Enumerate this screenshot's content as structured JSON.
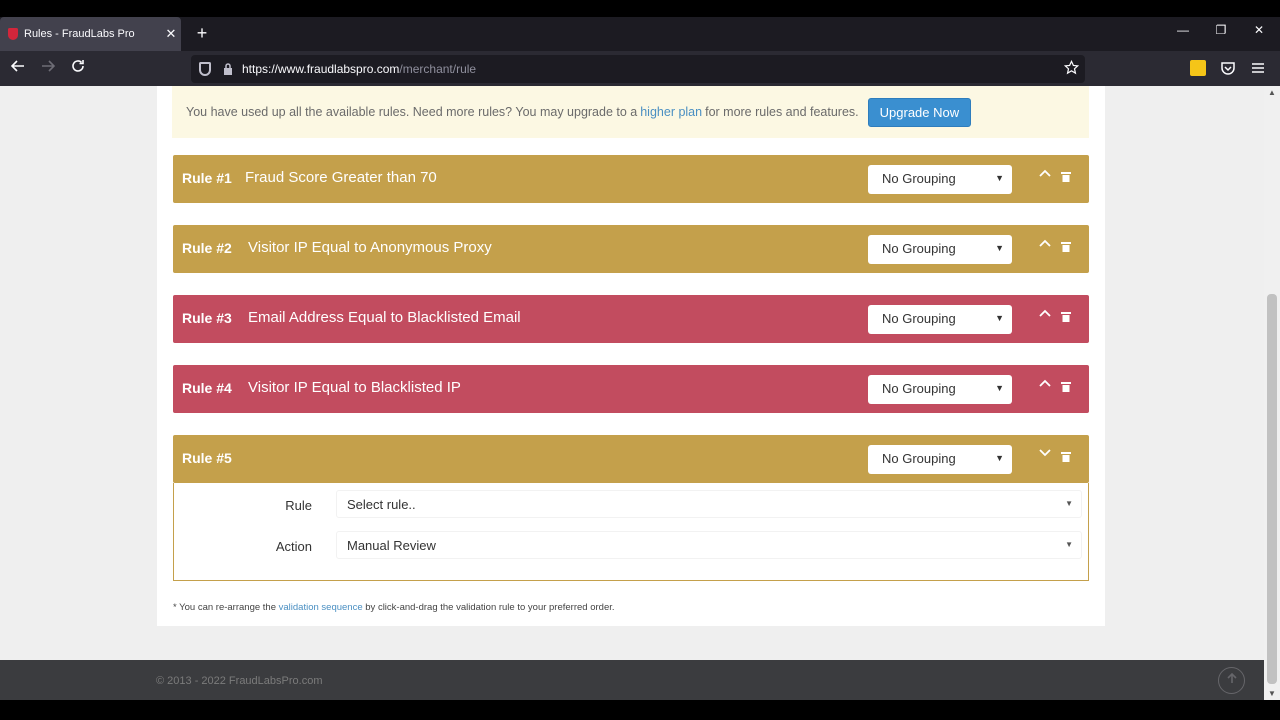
{
  "browser": {
    "tab_title": "Rules - FraudLabs Pro",
    "tab_close": "✕",
    "new_tab": "+",
    "url_host": "https://www.fraudlabspro.com",
    "url_path": "/merchant/rule",
    "minimize": "—",
    "restore": "❐",
    "close": "✕"
  },
  "notice": {
    "text_before": "You have used up all the available rules. Need more rules? You may upgrade to a",
    "link": "higher plan",
    "text_after": "for more rules and features.",
    "button": "Upgrade Now"
  },
  "rules": [
    {
      "num": "Rule #1",
      "title": "Fraud Score Greater than 70",
      "grouping": "No Grouping",
      "color": "#c4a04b"
    },
    {
      "num": "Rule #2",
      "title": "Visitor IP Equal to Anonymous Proxy",
      "grouping": "No Grouping",
      "color": "#c4a04b"
    },
    {
      "num": "Rule #3",
      "title": "Email Address Equal to Blacklisted Email",
      "grouping": "No Grouping",
      "color": "#c24c5f"
    },
    {
      "num": "Rule #4",
      "title": "Visitor IP Equal to Blacklisted IP",
      "grouping": "No Grouping",
      "color": "#c24c5f"
    },
    {
      "num": "Rule #5",
      "title": "",
      "grouping": "No Grouping",
      "color": "#c4a04b"
    }
  ],
  "rule_form": {
    "rule_label": "Rule",
    "rule_value": "Select rule..",
    "action_label": "Action",
    "action_value": "Manual Review"
  },
  "footnote": {
    "before": "* You can re-arrange the",
    "link": "validation sequence",
    "after": "by click-and-drag the validation rule to your preferred order."
  },
  "footer": {
    "copyright": "© 2013 - 2022 FraudLabsPro.com"
  }
}
